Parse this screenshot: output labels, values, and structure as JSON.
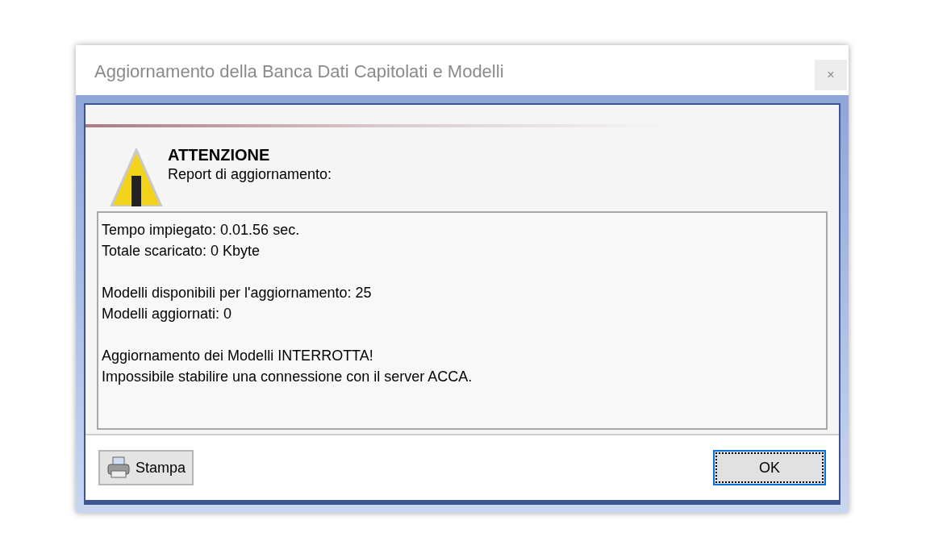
{
  "window": {
    "title": "Aggiornamento della Banca Dati Capitolati e Modelli",
    "close": "×"
  },
  "header": {
    "heading": "ATTENZIONE",
    "subtitle": "Report di aggiornamento:"
  },
  "report": [
    [
      "Tempo impiegato: 0.01.56 sec.",
      "Totale scaricato: 0 Kbyte"
    ],
    [
      "Modelli disponibili per l'aggiornamento: 25",
      "Modelli aggiornati: 0"
    ],
    [
      "Aggiornamento dei Modelli INTERROTTA!",
      "Impossibile stabilire una connessione con il server ACCA."
    ]
  ],
  "buttons": {
    "print": "Stampa",
    "ok": "OK"
  }
}
